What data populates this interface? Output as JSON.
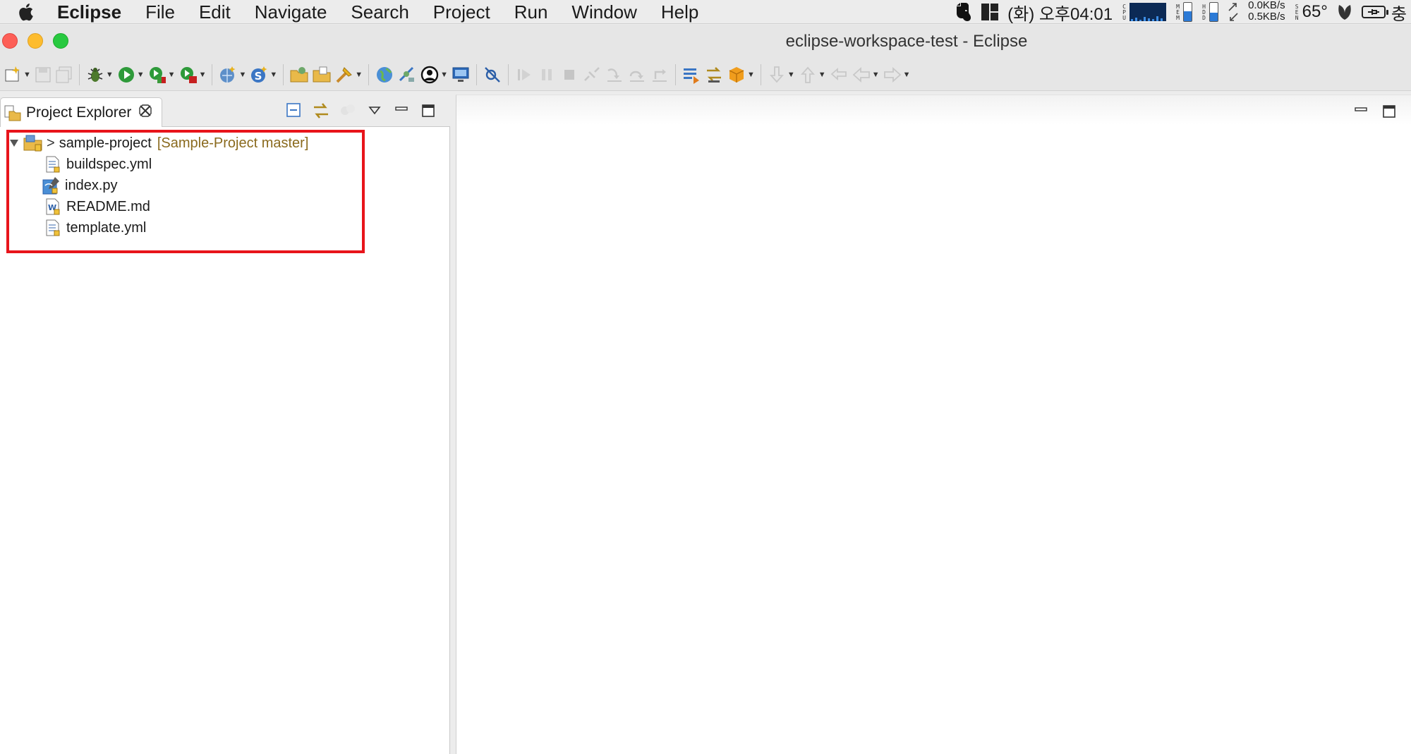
{
  "menubar": {
    "app_name": "Eclipse",
    "items": [
      "File",
      "Edit",
      "Navigate",
      "Search",
      "Project",
      "Run",
      "Window",
      "Help"
    ],
    "clock": "(화) 오후04:01",
    "cpu_label": "CPU",
    "mem_label": "MEM",
    "hdd_label": "HDD",
    "mem_level": 0.55,
    "hdd_level": 0.45,
    "net_up": "0.0KB/s",
    "net_down": "0.5KB/s",
    "sensor_label": "SEN",
    "temperature": "65°",
    "battery_text": "충"
  },
  "window": {
    "title": "eclipse-workspace-test - Eclipse"
  },
  "toolbar": {
    "icons": [
      "new-wizard-icon",
      "save-icon",
      "save-all-icon",
      "debug-icon",
      "run-icon",
      "coverage-icon",
      "external-tools-icon",
      "new-server-icon",
      "new-java-class-icon",
      "open-folder-icon",
      "open-file-icon",
      "search-tools-icon",
      "globe-icon",
      "connect-icon",
      "account-icon",
      "monitor-icon",
      "skip-breakpoints-icon",
      "resume-icon",
      "suspend-icon",
      "terminate-icon",
      "disconnect-icon",
      "step-into-icon",
      "step-over-icon",
      "step-return-icon",
      "task-list-icon",
      "sync-icon",
      "aws-icon",
      "next-annotation-icon",
      "previous-annotation-icon",
      "last-edit-icon",
      "back-icon",
      "forward-icon"
    ]
  },
  "explorer": {
    "tab_label": "Project Explorer",
    "tree": {
      "project": {
        "git_prefix": ">",
        "name": "sample-project",
        "decoration": "[Sample-Project master]"
      },
      "files": [
        {
          "name": "buildspec.yml",
          "icon": "yaml-file-icon"
        },
        {
          "name": "index.py",
          "icon": "python-file-icon"
        },
        {
          "name": "README.md",
          "icon": "markdown-file-icon"
        },
        {
          "name": "template.yml",
          "icon": "yaml-file-icon"
        }
      ]
    }
  },
  "colors": {
    "highlight": "#e8141b",
    "git_decoration": "#8a6a1e",
    "accent_blue": "#2c7ad6"
  }
}
